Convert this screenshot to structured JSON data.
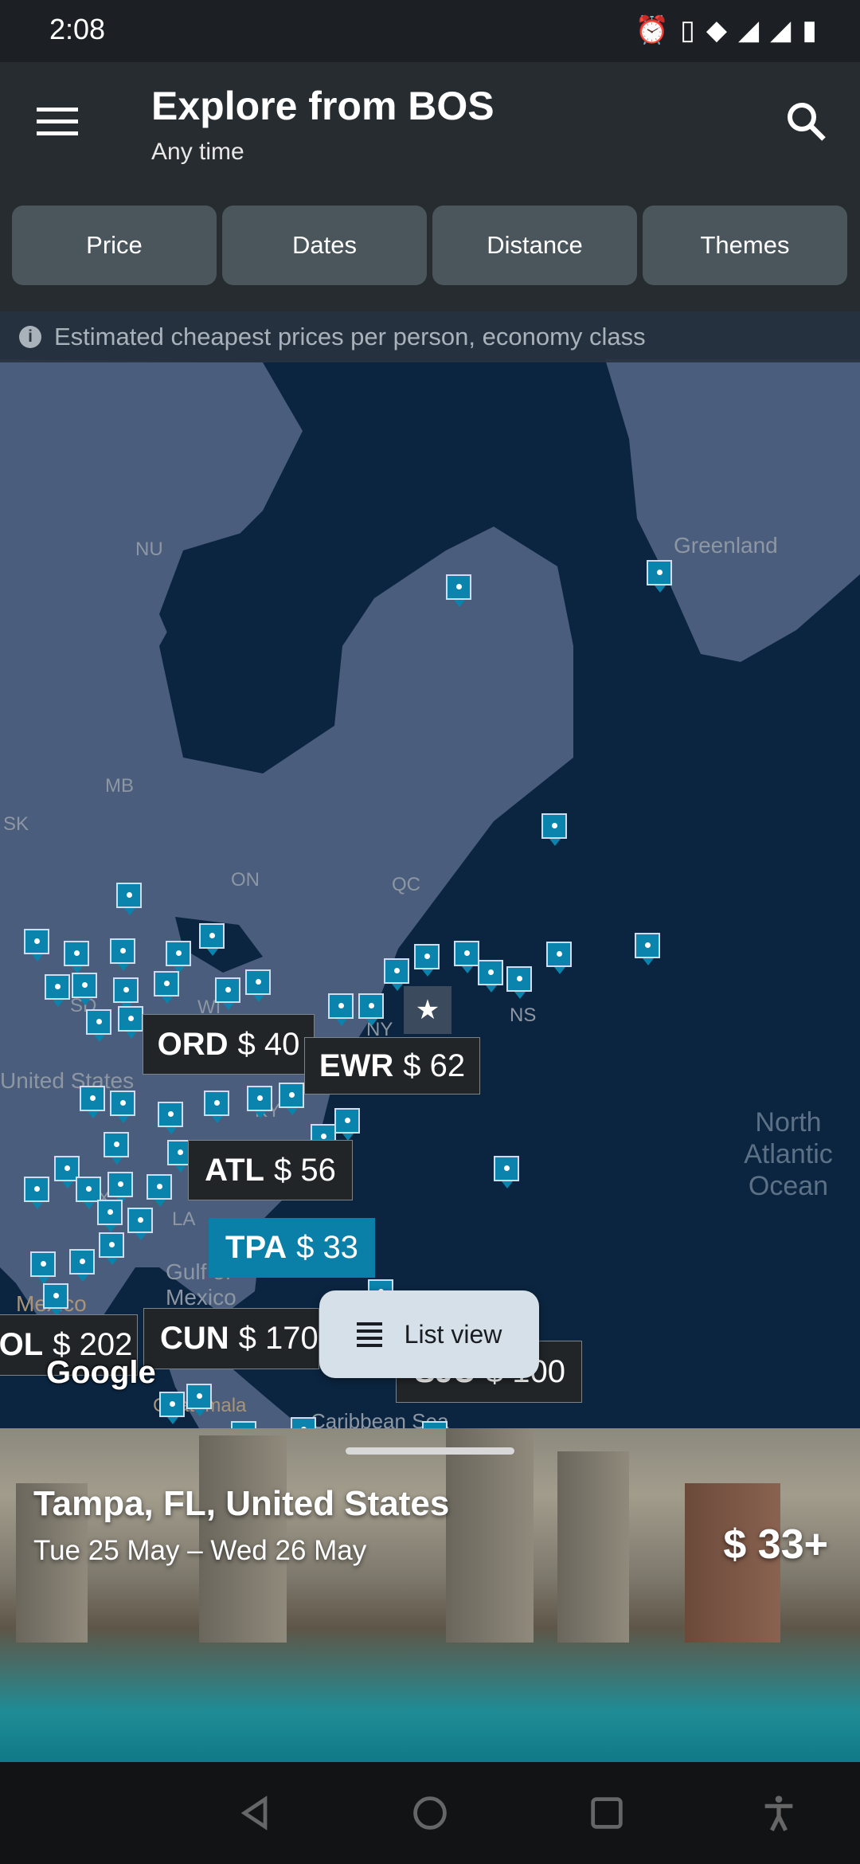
{
  "status_bar": {
    "time": "2:08",
    "icons": [
      "alarm-icon",
      "vibrate-icon",
      "wifi-icon",
      "signal-icon",
      "battery-icon"
    ]
  },
  "header": {
    "title": "Explore from BOS",
    "subtitle": "Any time"
  },
  "filters": [
    {
      "label": "Price"
    },
    {
      "label": "Dates"
    },
    {
      "label": "Distance"
    },
    {
      "label": "Themes"
    }
  ],
  "info": {
    "text": "Estimated cheapest prices per person, economy class"
  },
  "map": {
    "labels": {
      "nu": "NU",
      "mb": "MB",
      "sk": "SK",
      "on": "ON",
      "qc": "QC",
      "greenland": "Greenland",
      "us": "United States",
      "ocean": "North Atlantic Ocean",
      "gulf": "Gulf of Mexico",
      "mexico": "Mexico",
      "guatemala": "Guatemala",
      "caribbean": "Caribbean Sea",
      "ky": "KY",
      "ns": "NS",
      "tx": "TX",
      "la": "LA",
      "ny": "NY",
      "wi": "WI",
      "sd": "SD"
    },
    "price_labels": [
      {
        "code": "ORD",
        "price": "$ 40"
      },
      {
        "code": "EWR",
        "price": "$ 62"
      },
      {
        "code": "ATL",
        "price": "$ 56"
      },
      {
        "code": "TPA",
        "price": "$ 33",
        "selected": true
      },
      {
        "code": "CUN",
        "price": "$ 170"
      },
      {
        "code": "OL",
        "price": "$ 202"
      },
      {
        "code": "SJU",
        "price": "$ 100"
      }
    ],
    "list_view_label": "List view",
    "attribution": "Google",
    "colors": {
      "ocean": "#0b2540",
      "land": "#4b5d7c",
      "pin": "#0a84ad"
    }
  },
  "card": {
    "destination": "Tampa, FL, United States",
    "dates": "Tue 25 May – Wed 26 May",
    "price": "$ 33+"
  },
  "nav": {
    "icons": [
      "back-icon",
      "home-icon",
      "recents-icon",
      "accessibility-icon"
    ]
  }
}
